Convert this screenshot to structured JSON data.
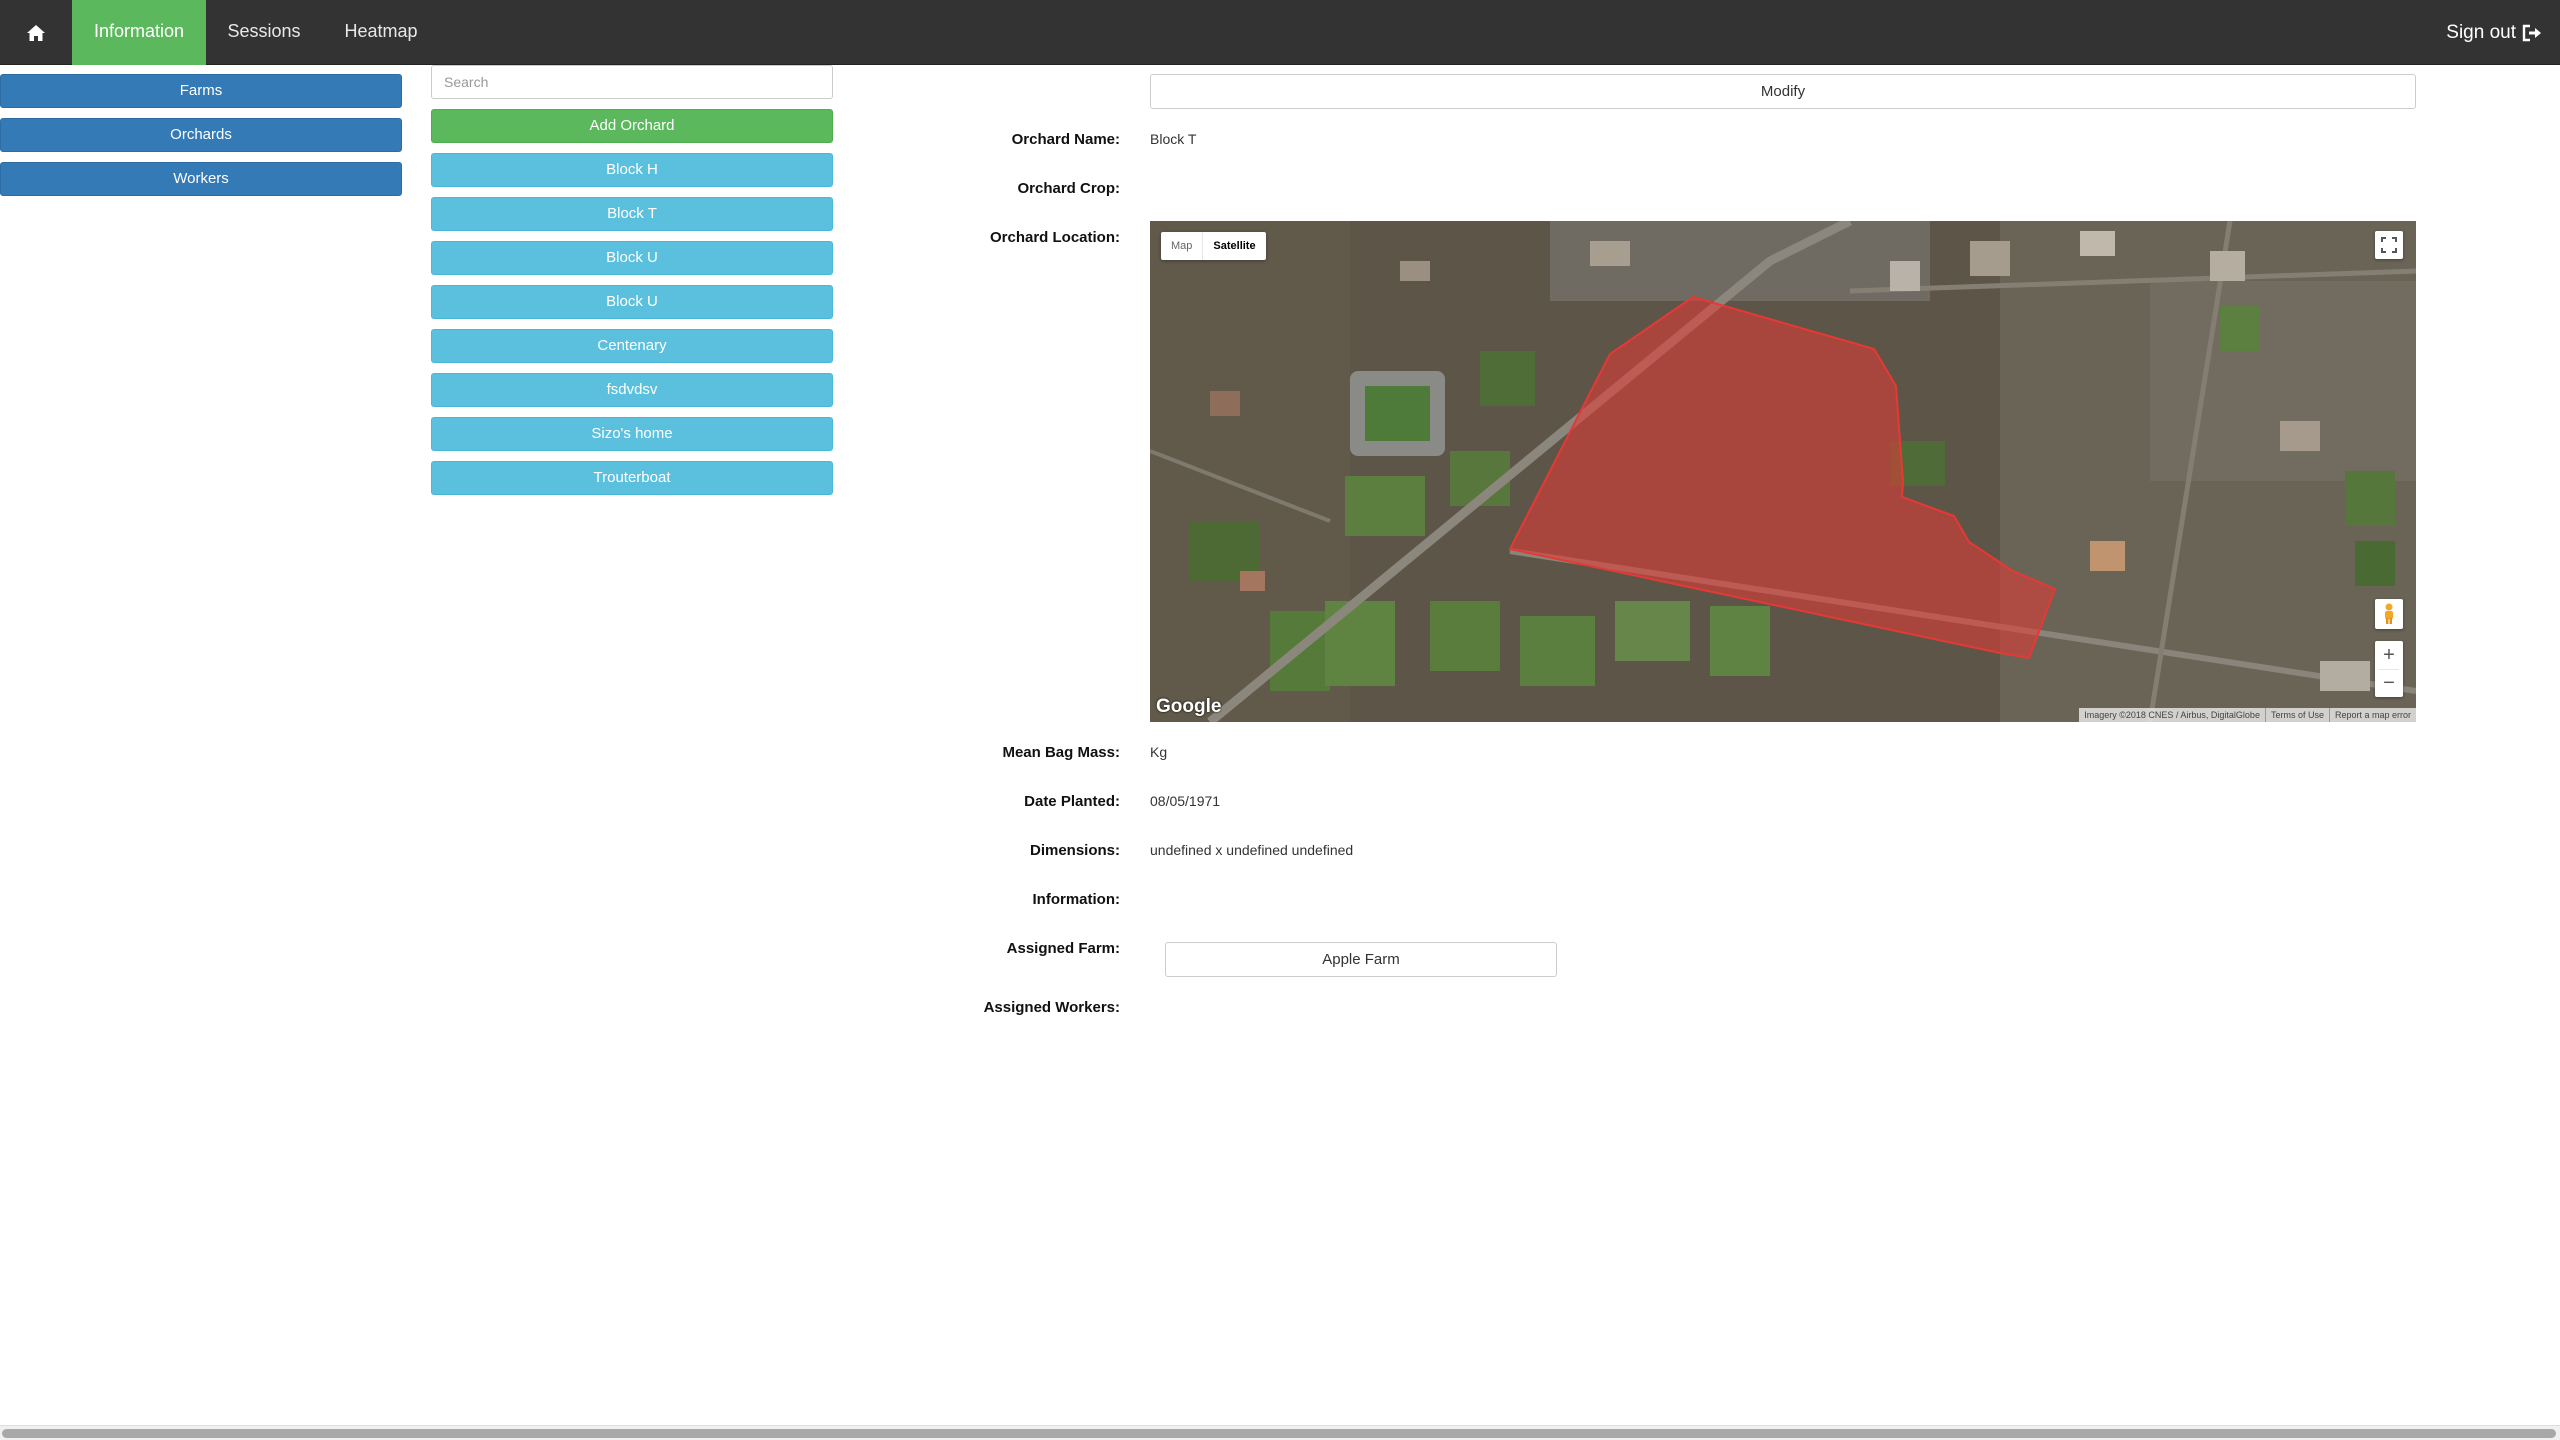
{
  "nav": {
    "home_icon": "home-icon",
    "tabs": [
      {
        "label": "Information",
        "active": true
      },
      {
        "label": "Sessions",
        "active": false
      },
      {
        "label": "Heatmap",
        "active": false
      }
    ],
    "signout_label": "Sign out",
    "signout_icon": "sign-out-icon"
  },
  "sidebar": {
    "items": [
      {
        "label": "Farms"
      },
      {
        "label": "Orchards"
      },
      {
        "label": "Workers"
      }
    ]
  },
  "orchards": {
    "search_placeholder": "Search",
    "add_label": "Add Orchard",
    "items": [
      "Block H",
      "Block T",
      "Block U",
      "Block U",
      "Centenary",
      "fsdvdsv",
      "Sizo's home",
      "Trouterboat"
    ]
  },
  "detail": {
    "modify_label": "Modify",
    "name_label": "Orchard Name:",
    "name_value": "Block T",
    "crop_label": "Orchard Crop:",
    "crop_value": "",
    "location_label": "Orchard Location:",
    "bag_mass_label": "Mean Bag Mass:",
    "bag_mass_value": "Kg",
    "date_label": "Date Planted:",
    "date_value": "08/05/1971",
    "dimensions_label": "Dimensions:",
    "dimensions_value": "undefined x undefined undefined",
    "information_label": "Information:",
    "information_value": "",
    "farm_label": "Assigned Farm:",
    "farm_value": "Apple Farm",
    "workers_label": "Assigned Workers:"
  },
  "map": {
    "type_map_label": "Map",
    "type_satellite_label": "Satellite",
    "selected_type": "Satellite",
    "logo_text": "Google",
    "attribution": "Imagery ©2018 CNES / Airbus, DigitalGlobe",
    "terms_label": "Terms of Use",
    "report_label": "Report a map error",
    "polygon_color": "#e53935",
    "fullscreen_icon": "fullscreen-icon",
    "pegman_icon": "pegman-icon",
    "zoom_in_label": "+",
    "zoom_out_label": "−"
  },
  "colors": {
    "navbar": "#333333",
    "active_tab": "#5cb85c",
    "primary": "#337ab7",
    "info": "#5bc0de",
    "success": "#5cb85c"
  }
}
